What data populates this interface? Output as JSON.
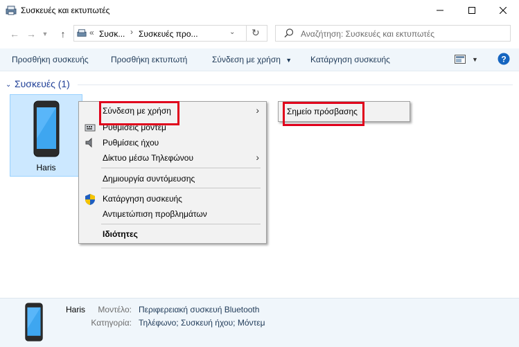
{
  "window": {
    "title": "Συσκευές και εκτυπωτές",
    "controls": {
      "minimize": "—",
      "maximize": "☐",
      "close": "✕"
    }
  },
  "address": {
    "breadcrumb_prefix": "«",
    "crumb1": "Συσκ...",
    "crumb2": "Συσκευές προ...",
    "search_placeholder": "Αναζήτηση: Συσκευές και εκτυπωτές"
  },
  "commandbar": {
    "add_device": "Προσθήκη συσκευής",
    "add_printer": "Προσθήκη εκτυπωτή",
    "connect_using": "Σύνδεση με χρήση",
    "remove_device": "Κατάργηση συσκευής"
  },
  "group": {
    "header": "Συσκευές (1)"
  },
  "device": {
    "name": "Haris"
  },
  "context_menu": {
    "items": [
      {
        "label": "Σύνδεση με χρήση",
        "icon": "none",
        "submenu": true,
        "highlighted": true
      },
      {
        "label": "Ρυθμίσεις μόντεμ",
        "icon": "modem-icon"
      },
      {
        "label": "Ρυθμίσεις ήχου",
        "icon": "speaker-icon"
      },
      {
        "label": "Δίκτυο μέσω Τηλεφώνου",
        "icon": "none",
        "submenu": true
      },
      {
        "label": "Δημιουργία συντόμευσης",
        "icon": "none"
      },
      {
        "label": "Κατάργηση συσκευής",
        "icon": "shield-icon"
      },
      {
        "label": "Αντιμετώπιση προβλημάτων",
        "icon": "none"
      },
      {
        "label": "Ιδιότητες",
        "icon": "none",
        "bold": true
      }
    ]
  },
  "submenu": {
    "items": [
      {
        "label": "Σημείο πρόσβασης",
        "highlighted": true
      }
    ]
  },
  "details": {
    "name": "Haris",
    "model_label": "Μοντέλο:",
    "model_value": "Περιφερειακή συσκευή Bluetooth",
    "category_label": "Κατηγορία:",
    "category_value": "Τηλέφωνο; Συσκευή ήχου; Μόντεμ"
  },
  "colors": {
    "accent": "#1e3e96",
    "highlight_box": "#e0001b",
    "selection": "#cce8ff",
    "help": "#1565c0"
  }
}
